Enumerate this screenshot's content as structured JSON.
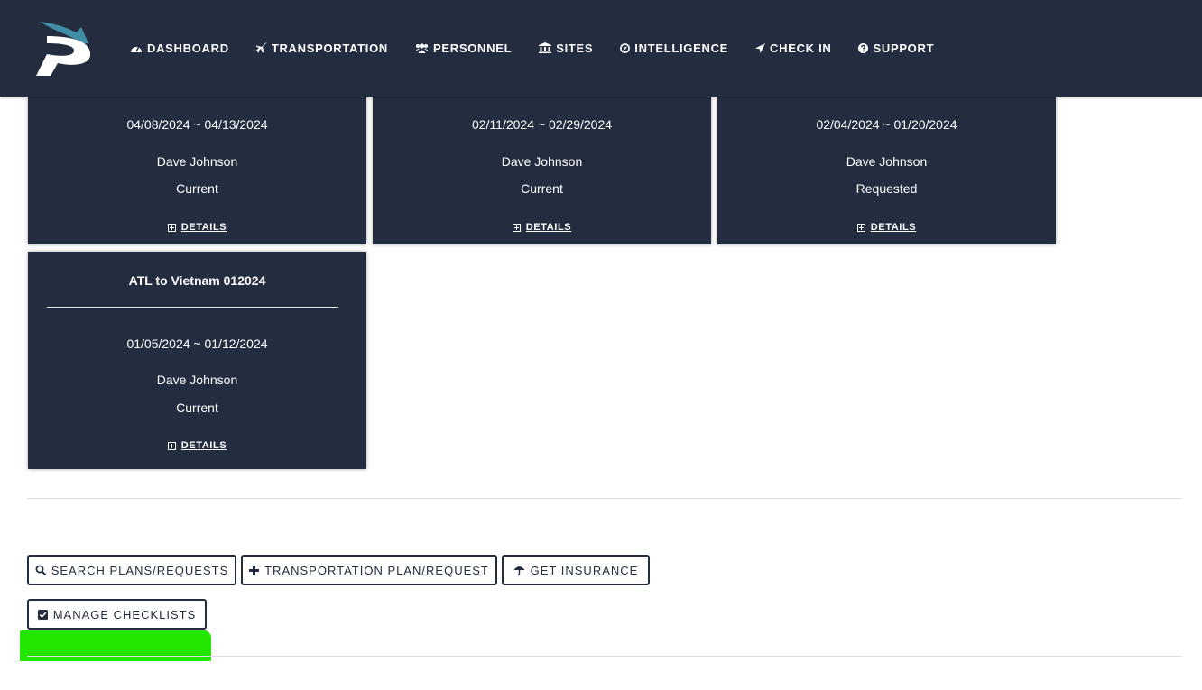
{
  "nav": {
    "items": [
      {
        "label": "DASHBOARD",
        "icon": "dashboard-icon"
      },
      {
        "label": "TRANSPORTATION",
        "icon": "plane-icon"
      },
      {
        "label": "PERSONNEL",
        "icon": "users-icon"
      },
      {
        "label": "SITES",
        "icon": "building-icon"
      },
      {
        "label": "INTELLIGENCE",
        "icon": "compass-icon"
      },
      {
        "label": "CHECK IN",
        "icon": "location-arrow-icon"
      },
      {
        "label": "SUPPORT",
        "icon": "question-circle-icon"
      }
    ]
  },
  "cards": [
    {
      "title": "",
      "dates": "04/08/2024 ~ 04/13/2024",
      "person": "Dave Johnson",
      "status": "Current",
      "details_label": "DETAILS"
    },
    {
      "title": "",
      "dates": "02/11/2024 ~ 02/29/2024",
      "person": "Dave Johnson",
      "status": "Current",
      "details_label": "DETAILS"
    },
    {
      "title": "",
      "dates": "02/04/2024 ~ 01/20/2024",
      "person": "Dave Johnson",
      "status": "Requested",
      "details_label": "DETAILS"
    },
    {
      "title": "ATL to Vietnam 012024",
      "dates": "01/05/2024 ~ 01/12/2024",
      "person": "Dave Johnson",
      "status": "Current",
      "details_label": "DETAILS"
    }
  ],
  "actions": {
    "search_label": "SEARCH PLANS/REQUESTS",
    "transport_label": "TRANSPORTATION PLAN/REQUEST",
    "insurance_label": "GET INSURANCE",
    "checklists_label": "MANAGE CHECKLISTS"
  },
  "colors": {
    "navy": "#232d3f",
    "logo_teal": "#3f8ea6",
    "highlight_green": "#22e500"
  }
}
